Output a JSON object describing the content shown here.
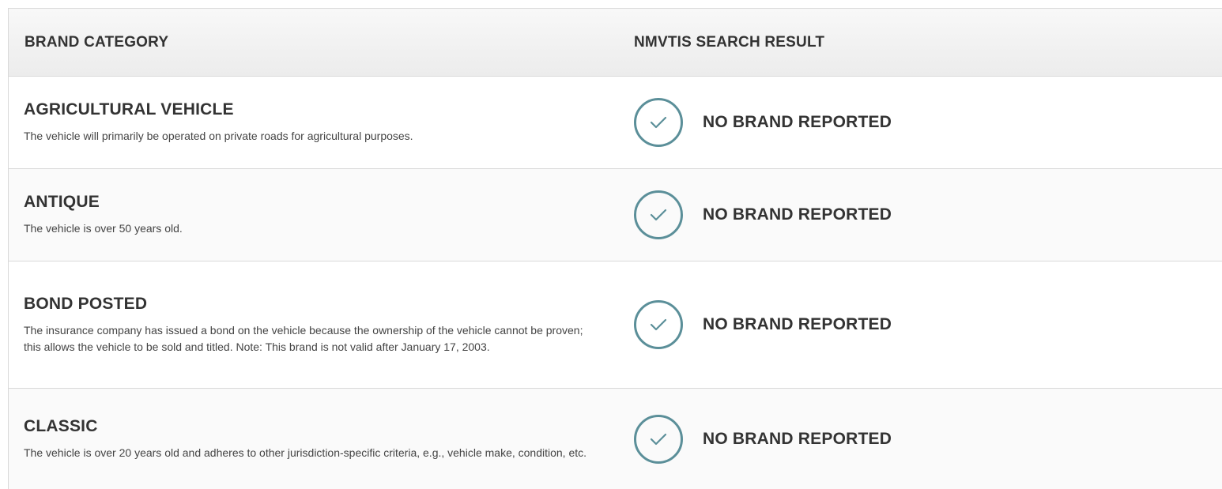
{
  "table": {
    "headers": {
      "brand_category": "BRAND CATEGORY",
      "search_result": "NMVTIS SEARCH RESULT"
    },
    "rows": [
      {
        "title": "AGRICULTURAL VEHICLE",
        "description": "The vehicle will primarily be operated on private roads for agricultural purposes.",
        "result": "NO BRAND REPORTED",
        "icon": "check-circle-icon"
      },
      {
        "title": "ANTIQUE",
        "description": "The vehicle is over 50 years old.",
        "result": "NO BRAND REPORTED",
        "icon": "check-circle-icon"
      },
      {
        "title": "BOND POSTED",
        "description": "The insurance company has issued a bond on the vehicle because the ownership of the vehicle cannot be proven; this allows the vehicle to be sold and titled. Note: This brand is not valid after January 17, 2003.",
        "result": "NO BRAND REPORTED",
        "icon": "check-circle-icon"
      },
      {
        "title": "CLASSIC",
        "description": "The vehicle is over 20 years old and adheres to other jurisdiction-specific criteria, e.g., vehicle make, condition, etc.",
        "result": "NO BRAND REPORTED",
        "icon": "check-circle-icon"
      }
    ]
  },
  "colors": {
    "check_accent": "#5b8f99",
    "header_bg": "#efefef",
    "border": "#d9d9d9",
    "text": "#333333"
  }
}
